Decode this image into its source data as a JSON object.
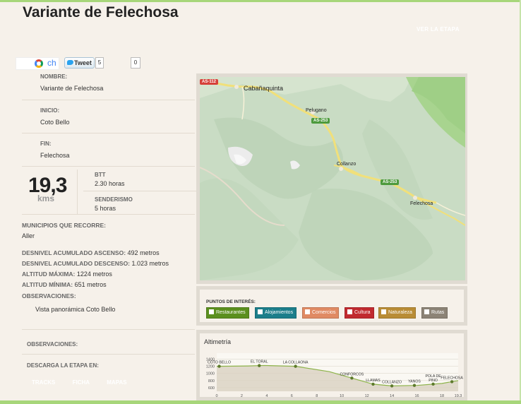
{
  "page": {
    "title": "Variante de Felechosa",
    "ver_etapa": "VER LA ETAPA"
  },
  "share": {
    "gplus_text": "ch",
    "tweet_label": "Tweet",
    "tweet_count": "5",
    "like_count": "0"
  },
  "route": {
    "nombre_label": "NOMBRE:",
    "nombre": "Variante de Felechosa",
    "inicio_label": "INICIO:",
    "inicio": "Coto Bello",
    "fin_label": "FIN:",
    "fin": "Felechosa",
    "distance": "19,3",
    "distance_unit": "kms",
    "btt_label": "BTT",
    "btt": "2.30 horas",
    "senderismo_label": "SENDERISMO",
    "senderismo": "5 horas"
  },
  "details": {
    "municipios_label": "MUNICIPIOS QUE RECORRE:",
    "municipios": "Aller",
    "ascenso_label": "DESNIVEL ACUMULADO ASCENSO:",
    "ascenso": "492 metros",
    "descenso_label": "DESNIVEL ACUMULADO DESCENSO:",
    "descenso": "1.023 metros",
    "altmax_label": "ALTITUD MÁXIMA:",
    "altmax": "1224 metros",
    "altmin_label": "ALTITUD MÍNIMA:",
    "altmin": "651 metros",
    "obs_label": "OBSERVACIONES:",
    "obs": "Vista panorámica Coto Bello"
  },
  "lower": {
    "obs_label": "OBSERVACIONES:",
    "descarga_label": "DESCARGA LA ETAPA EN:",
    "links": [
      "TRACKS",
      "FICHA",
      "MAPAS"
    ]
  },
  "map": {
    "labels": {
      "cabanaquinta": "Cabañaquinta",
      "pelugano": "Pelugano",
      "collanzo": "Collanzo",
      "felechosa": "Felechosa"
    },
    "roads": {
      "as112": "AS-112",
      "as253a": "AS-253",
      "as253b": "AS-253"
    }
  },
  "poi": {
    "title": "PUNTOS DE INTERÉS:",
    "chips": [
      {
        "label": "Restaurantes",
        "color": "#5b8f1e"
      },
      {
        "label": "Alojamientos",
        "color": "#1c7e8a"
      },
      {
        "label": "Comercios",
        "color": "#e08a63"
      },
      {
        "label": "Cultura",
        "color": "#c12a2f"
      },
      {
        "label": "Naturaleza",
        "color": "#b98c35"
      },
      {
        "label": "Rutas",
        "color": "#8c8376"
      }
    ]
  },
  "altimetria": {
    "title": "Altimetría",
    "chart_data": {
      "type": "area",
      "x": [
        0,
        2.5,
        3.8,
        6.3,
        9,
        11,
        12.5,
        14,
        16,
        18,
        19.3
      ],
      "y": [
        1200,
        1210,
        1224,
        1200,
        1050,
        850,
        700,
        651,
        665,
        720,
        800
      ],
      "xticks": [
        "0",
        "2",
        "4",
        "6",
        "8",
        "10",
        "12",
        "14",
        "16",
        "18",
        "19,3"
      ],
      "yticks": [
        "1400",
        "1200",
        "1000",
        "800",
        "600"
      ],
      "ylim": [
        500,
        1450
      ],
      "xlim": [
        0,
        19.3
      ],
      "point_labels": [
        "COTO BELLO",
        "EL TORAL",
        "LA COLLAONA",
        "CONFORCOS",
        "LLAMAS",
        "COLLANZO",
        "YANOS",
        "POLA DE PINO",
        "FELECHOSA"
      ],
      "point_label_x": [
        0.2,
        3.4,
        6.3,
        10.8,
        12.5,
        14,
        15.8,
        17.3,
        18.8
      ]
    }
  }
}
